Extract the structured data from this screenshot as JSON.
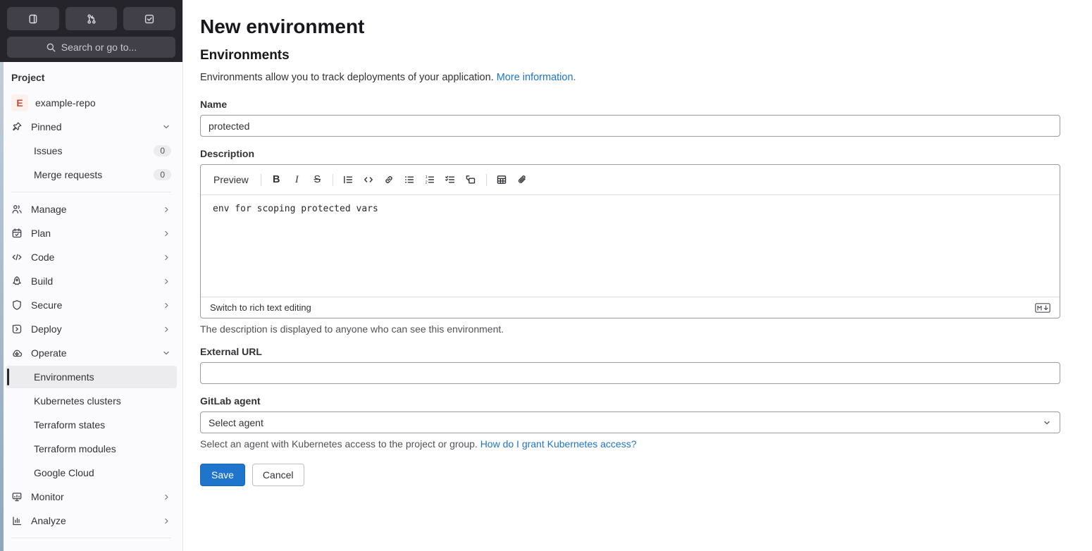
{
  "colors": {
    "accent_blue": "#1f75cb",
    "header_dark": "#26242b",
    "sidebar_bg": "#fbfafd",
    "active_item_bg": "#ececef",
    "avatar_bg": "#fdf1ee",
    "avatar_text": "#c24a38",
    "save_button_bg": "#1f75cb"
  },
  "sidebar": {
    "header_icons": [
      "issues-icon",
      "merge-request-icon",
      "todo-checkbox-icon"
    ],
    "search_placeholder": "Search or go to...",
    "section_label": "Project",
    "project": {
      "avatar_letter": "E",
      "name": "example-repo"
    },
    "pinned": {
      "label": "Pinned",
      "items": [
        {
          "label": "Issues",
          "badge": "0"
        },
        {
          "label": "Merge requests",
          "badge": "0"
        }
      ]
    },
    "menu": [
      {
        "label": "Manage",
        "icon": "users-icon"
      },
      {
        "label": "Plan",
        "icon": "calendar-icon"
      },
      {
        "label": "Code",
        "icon": "code-icon"
      },
      {
        "label": "Build",
        "icon": "rocket-icon"
      },
      {
        "label": "Secure",
        "icon": "shield-icon"
      },
      {
        "label": "Deploy",
        "icon": "deploy-icon"
      },
      {
        "label": "Operate",
        "icon": "cloud-gear-icon"
      }
    ],
    "operate_children": [
      {
        "label": "Environments"
      },
      {
        "label": "Kubernetes clusters"
      },
      {
        "label": "Terraform states"
      },
      {
        "label": "Terraform modules"
      },
      {
        "label": "Google Cloud"
      }
    ],
    "bottom_menu": [
      {
        "label": "Monitor",
        "icon": "monitor-icon"
      },
      {
        "label": "Analyze",
        "icon": "bar-chart-icon"
      }
    ]
  },
  "main": {
    "title": "New environment",
    "section_title": "Environments",
    "lead_text": "Environments allow you to track deployments of your application.",
    "lead_link": "More information.",
    "name_field": {
      "label": "Name",
      "value": "protected"
    },
    "description_field": {
      "label": "Description",
      "preview_label": "Preview",
      "toolbar_icons": [
        "bold",
        "italic",
        "strikethrough",
        "heading",
        "code",
        "link",
        "bulleted-list",
        "numbered-list",
        "task-list",
        "collapsible-section",
        "table",
        "attach-file"
      ],
      "content": "env for scoping protected vars",
      "switch_label": "Switch to rich text editing",
      "markdown_icon": "markdown-icon",
      "help": "The description is displayed to anyone who can see this environment."
    },
    "external_url_field": {
      "label": "External URL",
      "value": ""
    },
    "agent_field": {
      "label": "GitLab agent",
      "selected": "Select agent",
      "help_text": "Select an agent with Kubernetes access to the project or group.",
      "help_link": "How do I grant Kubernetes access?"
    },
    "buttons": {
      "save": "Save",
      "cancel": "Cancel"
    }
  }
}
